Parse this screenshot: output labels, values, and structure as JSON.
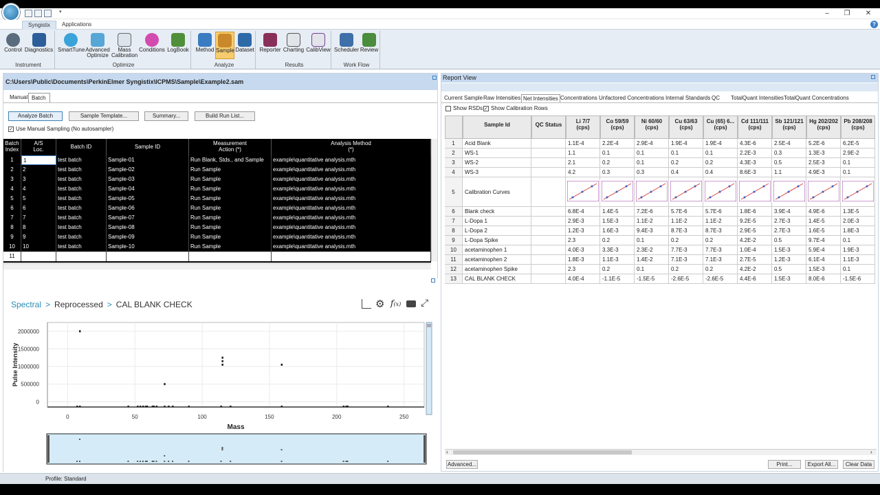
{
  "ribbon": {
    "tabs": [
      "Syngistix",
      "Applications"
    ],
    "groups": [
      {
        "title": "Instrument",
        "buttons": [
          {
            "label": "Control",
            "icon": "gauge-icon"
          },
          {
            "label": "Diagnostics",
            "icon": "pulse-icon"
          }
        ]
      },
      {
        "title": "Optimize",
        "buttons": [
          {
            "label": "SmartTune",
            "icon": "smarttune-icon"
          },
          {
            "label": "Advanced\nOptimize",
            "icon": "advanced-optimize-icon"
          },
          {
            "label": "Mass\nCalibration",
            "icon": "mass-calibration-icon"
          },
          {
            "label": "Conditions",
            "icon": "conditions-icon"
          },
          {
            "label": "LogBook",
            "icon": "logbook-icon"
          }
        ]
      },
      {
        "title": "Analyze",
        "buttons": [
          {
            "label": "Method",
            "icon": "method-icon"
          },
          {
            "label": "Sample",
            "icon": "sample-icon"
          },
          {
            "label": "Dataset",
            "icon": "dataset-icon"
          }
        ]
      },
      {
        "title": "Results",
        "buttons": [
          {
            "label": "Reporter",
            "icon": "reporter-icon"
          },
          {
            "label": "Charting",
            "icon": "charting-icon"
          },
          {
            "label": "CalibView",
            "icon": "calibview-icon"
          }
        ]
      },
      {
        "title": "Work Flow",
        "buttons": [
          {
            "label": "Scheduler",
            "icon": "scheduler-icon"
          },
          {
            "label": "Review",
            "icon": "review-icon"
          }
        ]
      }
    ]
  },
  "left": {
    "path": "C:\\Users\\Public\\Documents\\PerkinElmer Syngistix\\ICPMS\\Sample\\Example2.sam",
    "tabs": [
      "Manual",
      "Batch"
    ],
    "buttons": [
      "Analyze Batch",
      "Sample Template...",
      "Summary...",
      "Build Run List..."
    ],
    "manual_sampling_label": "Use Manual Sampling (No autosampler)",
    "grid_headers": [
      "Batch\nIndex",
      "A/S\nLoc.",
      "Batch ID",
      "Sample ID",
      "Measurement\nAction (*)",
      "Analysis Method\n(*)"
    ],
    "rows": [
      [
        "1",
        "1",
        "test batch",
        "Sample-01",
        "Run Blank, Stds., and Sample",
        "example\\quantitative analysis.mth"
      ],
      [
        "2",
        "2",
        "test batch",
        "Sample-02",
        "Run Sample",
        "example\\quantitative analysis.mth"
      ],
      [
        "3",
        "3",
        "test batch",
        "Sample-03",
        "Run Sample",
        "example\\quantitative analysis.mth"
      ],
      [
        "4",
        "4",
        "test batch",
        "Sample-04",
        "Run Sample",
        "example\\quantitative analysis.mth"
      ],
      [
        "5",
        "5",
        "test batch",
        "Sample-05",
        "Run Sample",
        "example\\quantitative analysis.mth"
      ],
      [
        "6",
        "6",
        "test batch",
        "Sample-06",
        "Run Sample",
        "example\\quantitative analysis.mth"
      ],
      [
        "7",
        "7",
        "test batch",
        "Sample-07",
        "Run Sample",
        "example\\quantitative analysis.mth"
      ],
      [
        "8",
        "8",
        "test batch",
        "Sample-08",
        "Run Sample",
        "example\\quantitative analysis.mth"
      ],
      [
        "9",
        "9",
        "test batch",
        "Sample-09",
        "Run Sample",
        "example\\quantitative analysis.mth"
      ],
      [
        "10",
        "10",
        "test batch",
        "Sample-10",
        "Run Sample",
        "example\\quantitative analysis.mth"
      ],
      [
        "11",
        "",
        "",
        "",
        "",
        ""
      ]
    ]
  },
  "breadcrumb": {
    "part1": "Spectral",
    "part2": "Reprocessed",
    "part3": "CAL BLANK CHECK",
    "separator": ">"
  },
  "chart_data": {
    "type": "scatter",
    "xlabel": "Mass",
    "ylabel": "Pulse Intensity",
    "xlim": [
      -15,
      265
    ],
    "ylim": [
      -150000,
      2250000
    ],
    "xticks": [
      0,
      50,
      100,
      150,
      200,
      250
    ],
    "yticks": [
      0,
      500000,
      1000000,
      1500000,
      2000000
    ],
    "ytick_labels": [
      "0",
      "500000",
      "1000000",
      "1500000",
      "2000000"
    ],
    "grid": true,
    "points": [
      [
        7,
        0
      ],
      [
        9,
        2000000
      ],
      [
        9,
        0
      ],
      [
        45,
        0
      ],
      [
        52,
        0
      ],
      [
        54,
        0
      ],
      [
        56,
        0
      ],
      [
        58,
        0
      ],
      [
        59,
        0
      ],
      [
        63,
        0
      ],
      [
        64,
        0
      ],
      [
        66,
        0
      ],
      [
        72,
        500000
      ],
      [
        72,
        0
      ],
      [
        75,
        0
      ],
      [
        78,
        0
      ],
      [
        90,
        0
      ],
      [
        114,
        0
      ],
      [
        115,
        1250000
      ],
      [
        115,
        1150000
      ],
      [
        115,
        1050000
      ],
      [
        121,
        0
      ],
      [
        159,
        1050000
      ],
      [
        159,
        0
      ],
      [
        205,
        0
      ],
      [
        207,
        0
      ],
      [
        208,
        0
      ],
      [
        238,
        0
      ]
    ]
  },
  "right": {
    "title": "Report View",
    "tabs": [
      "Current Sample",
      "Raw Intensities",
      "Net Intensities",
      "Concentrations",
      "Unfactored Concentrations",
      "Internal Standards",
      "QC",
      "TotalQuant Intensities",
      "TotalQuant Concentrations"
    ],
    "active_tab": 2,
    "show_rsds": "Show RSDs",
    "show_calib": "Show Calibration Rows",
    "headers": [
      "",
      "Sample Id",
      "QC Status",
      "Li 7/7\n(cps)",
      "Co 59/59\n(cps)",
      "Ni 60/60\n(cps)",
      "Cu 63/63\n(cps)",
      "Cu (65) 6...\n(cps)",
      "Cd 111/111\n(cps)",
      "Sb 121/121\n(cps)",
      "Hg 202/202\n(cps)",
      "Pb 208/208\n(cps)"
    ],
    "rows": [
      [
        "1",
        "Acid Blank",
        "",
        "1.1E-4",
        "2.2E-4",
        "2.9E-4",
        "1.9E-4",
        "1.9E-4",
        "4.3E-6",
        "2.5E-4",
        "5.2E-6",
        "6.2E-5"
      ],
      [
        "2",
        "WS-1",
        "",
        "1.1",
        "0.1",
        "0.1",
        "0.1",
        "0.1",
        "2.2E-3",
        "0.3",
        "1.3E-3",
        "2.9E-2"
      ],
      [
        "3",
        "WS-2",
        "",
        "2.1",
        "0.2",
        "0.1",
        "0.2",
        "0.2",
        "4.3E-3",
        "0.5",
        "2.5E-3",
        "0.1"
      ],
      [
        "4",
        "WS-3",
        "",
        "4.2",
        "0.3",
        "0.3",
        "0.4",
        "0.4",
        "8.6E-3",
        "1.1",
        "4.9E-3",
        "0.1"
      ],
      [
        "5",
        "Calibration Curves",
        "",
        "",
        "",
        "",
        "",
        "",
        "",
        "",
        "",
        ""
      ],
      [
        "6",
        "Blank check",
        "",
        "6.8E-4",
        "1.4E-5",
        "7.2E-6",
        "5.7E-6",
        "5.7E-6",
        "1.8E-6",
        "3.9E-4",
        "4.9E-6",
        "1.3E-5"
      ],
      [
        "7",
        "L-Dopa 1",
        "",
        "2.9E-3",
        "1.5E-3",
        "1.1E-2",
        "1.1E-2",
        "1.1E-2",
        "9.2E-5",
        "2.7E-3",
        "1.4E-5",
        "2.0E-3"
      ],
      [
        "8",
        "L-Dopa 2",
        "",
        "1.2E-3",
        "1.6E-3",
        "9.4E-3",
        "8.7E-3",
        "8.7E-3",
        "2.9E-5",
        "2.7E-3",
        "1.6E-5",
        "1.8E-3"
      ],
      [
        "9",
        "L-Dopa Spike",
        "",
        "2.3",
        "0.2",
        "0.1",
        "0.2",
        "0.2",
        "4.2E-2",
        "0.5",
        "9.7E-4",
        "0.1"
      ],
      [
        "10",
        "acetaminophen 1",
        "",
        "4.0E-3",
        "3.3E-3",
        "2.3E-2",
        "7.7E-3",
        "7.7E-3",
        "1.0E-4",
        "1.5E-3",
        "5.9E-4",
        "1.9E-3"
      ],
      [
        "11",
        "acetaminophen 2",
        "",
        "1.8E-3",
        "1.1E-3",
        "1.4E-2",
        "7.1E-3",
        "7.1E-3",
        "2.7E-5",
        "1.2E-3",
        "6.1E-4",
        "1.1E-3"
      ],
      [
        "12",
        "acetaminophen Spike",
        "",
        "2.3",
        "0.2",
        "0.1",
        "0.2",
        "0.2",
        "4.2E-2",
        "0.5",
        "1.5E-3",
        "0.1"
      ],
      [
        "13",
        "CAL BLANK CHECK",
        "",
        "4.0E-4",
        "-1.1E-5",
        "-1.5E-5",
        "-2.6E-5",
        "-2.6E-5",
        "4.4E-6",
        "1.5E-3",
        "8.0E-6",
        "-1.5E-6"
      ]
    ],
    "buttons": {
      "advanced": "Advanced...",
      "print": "Print...",
      "export": "Export All...",
      "clear": "Clear Data"
    }
  },
  "status": {
    "profile": "Profile: Standard"
  },
  "colors": {
    "accent": "#2a8db5",
    "calib_line": "#d94040",
    "calib_point": "#3b5cc4",
    "calib_axis": "#9a3ca0",
    "selected_button": "#f6cc6e"
  }
}
